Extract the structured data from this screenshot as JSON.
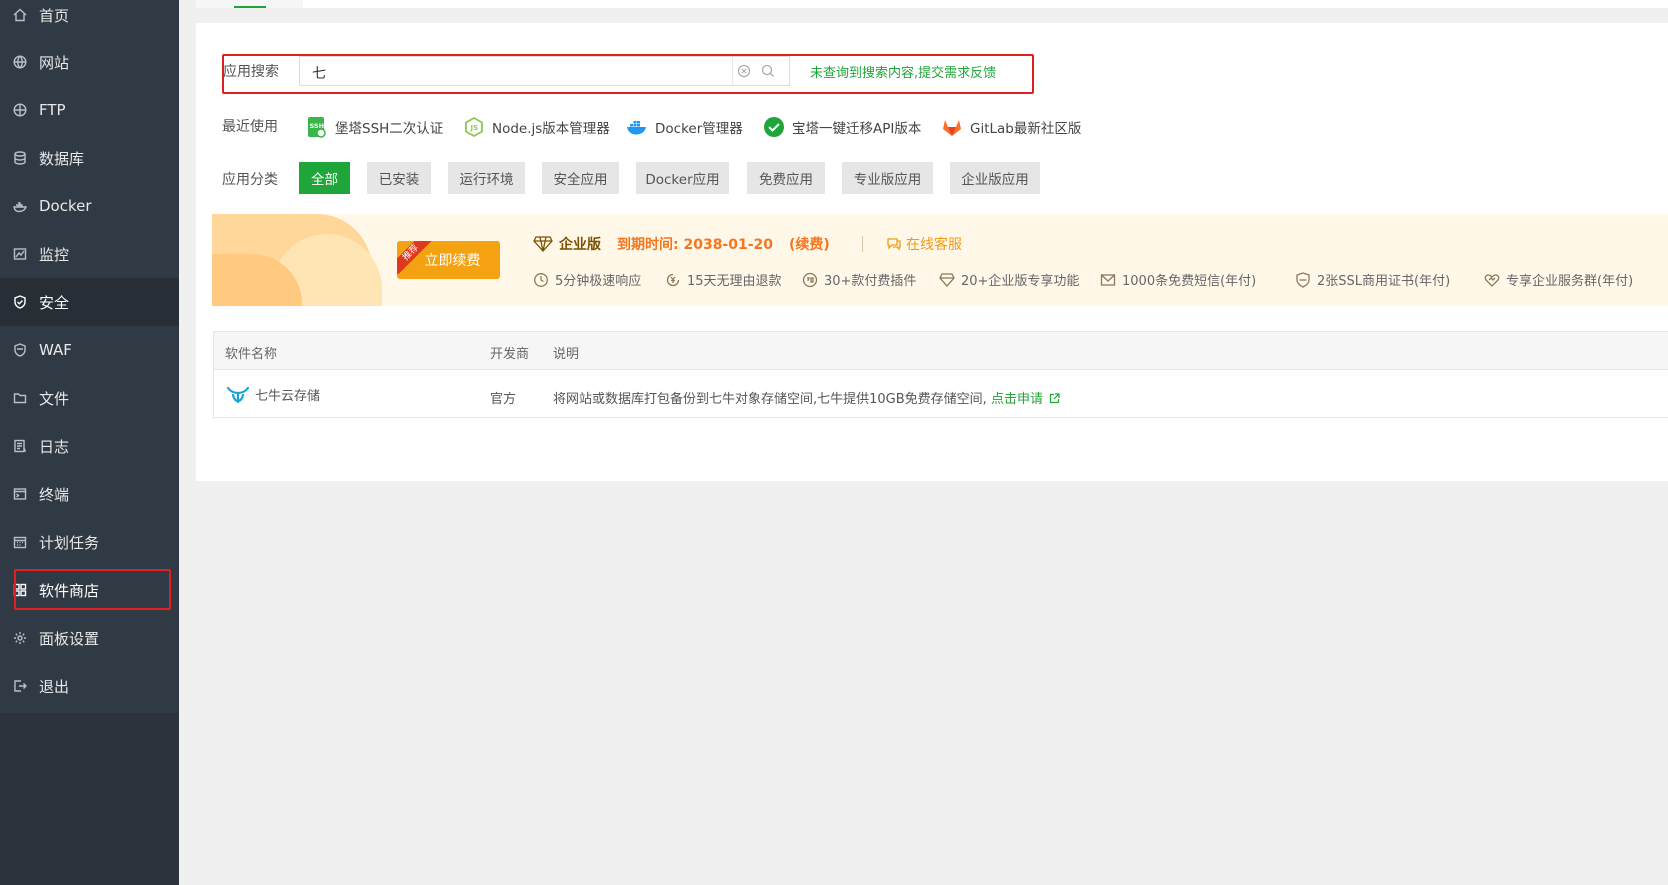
{
  "sidebar": {
    "items": [
      {
        "label": "首页",
        "icon": "home-icon"
      },
      {
        "label": "网站",
        "icon": "globe-icon"
      },
      {
        "label": "FTP",
        "icon": "ftp-globe-icon"
      },
      {
        "label": "数据库",
        "icon": "database-icon"
      },
      {
        "label": "Docker",
        "icon": "docker-icon"
      },
      {
        "label": "监控",
        "icon": "monitor-chart-icon"
      },
      {
        "label": "安全",
        "icon": "shield-icon"
      },
      {
        "label": "WAF",
        "icon": "waf-shield-icon"
      },
      {
        "label": "文件",
        "icon": "folder-icon"
      },
      {
        "label": "日志",
        "icon": "log-icon"
      },
      {
        "label": "终端",
        "icon": "terminal-icon"
      },
      {
        "label": "计划任务",
        "icon": "calendar-icon"
      },
      {
        "label": "软件商店",
        "icon": "grid-apps-icon"
      },
      {
        "label": "面板设置",
        "icon": "gear-icon"
      },
      {
        "label": "退出",
        "icon": "logout-icon"
      }
    ]
  },
  "search": {
    "label": "应用搜索",
    "value": "七",
    "feedback": "未查询到搜索内容,提交需求反馈"
  },
  "recent": {
    "label": "最近使用",
    "items": [
      {
        "label": "堡塔SSH二次认证",
        "icon": "ssh-icon"
      },
      {
        "label": "Node.js版本管理器",
        "icon": "nodejs-icon"
      },
      {
        "label": "Docker管理器",
        "icon": "docker-whale-icon"
      },
      {
        "label": "宝塔一键迁移API版本",
        "icon": "check-circle-icon"
      },
      {
        "label": "GitLab最新社区版",
        "icon": "gitlab-icon"
      }
    ]
  },
  "categories": {
    "label": "应用分类",
    "items": [
      "全部",
      "已安装",
      "运行环境",
      "安全应用",
      "Docker应用",
      "免费应用",
      "专业版应用",
      "企业版应用"
    ],
    "active": "全部"
  },
  "banner": {
    "badge": "推荐",
    "renew": "立即续费",
    "edition": "企业版",
    "expire": "到期时间: 2038-01-20",
    "renew_link": "(续费)",
    "service": "在线客服",
    "features": [
      "5分钟极速响应",
      "15天无理由退款",
      "30+款付费插件",
      "20+企业版专享功能",
      "1000条免费短信(年付)",
      "2张SSL商用证书(年付)",
      "专享企业服务群(年付)"
    ]
  },
  "table": {
    "headers": [
      "软件名称",
      "开发商",
      "说明"
    ],
    "rows": [
      {
        "name": "七牛云存储",
        "developer": "官方",
        "description": "将网站或数据库打包备份到七牛对象存储空间,七牛提供10GB免费存储空间,",
        "link": "点击申请"
      }
    ]
  },
  "colors": {
    "sidebar": "#303a45",
    "accent": "#20a53a",
    "highlight": "#e02020",
    "renew_button": "#f4a112"
  }
}
